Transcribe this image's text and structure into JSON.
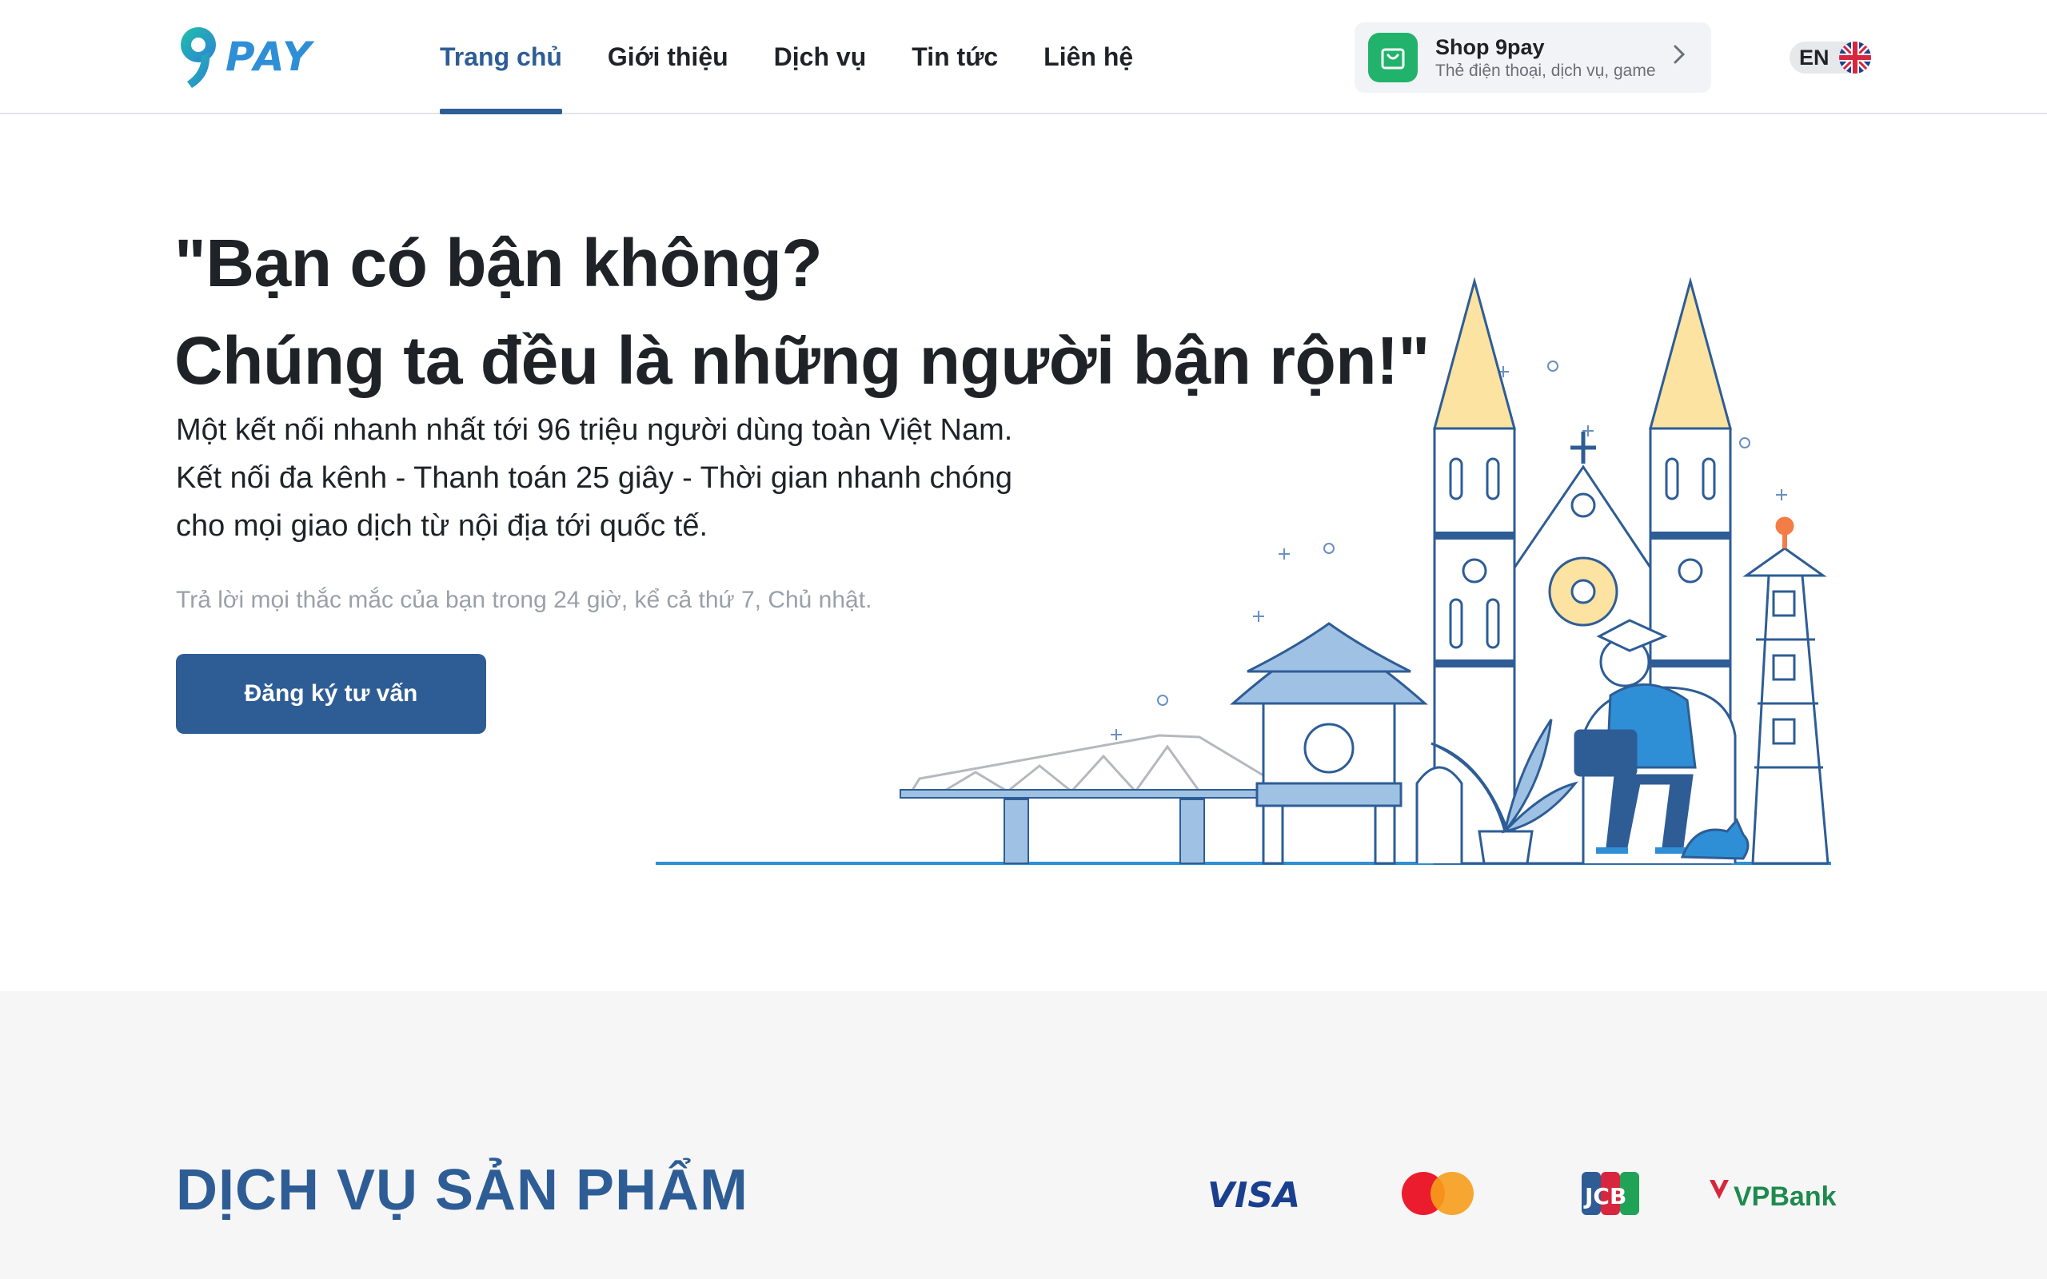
{
  "brand": {
    "logo_text": "PAY",
    "logo_alt": "9pay"
  },
  "nav": {
    "items": [
      {
        "label": "Trang chủ",
        "active": true
      },
      {
        "label": "Giới thiệu",
        "active": false
      },
      {
        "label": "Dịch vụ",
        "active": false
      },
      {
        "label": "Tin tức",
        "active": false
      },
      {
        "label": "Liên hệ",
        "active": false
      }
    ]
  },
  "shop": {
    "title": "Shop 9pay",
    "subtitle": "Thẻ điện thoại, dịch vụ, game",
    "icon": "shopping-bag-icon"
  },
  "language": {
    "label": "EN",
    "flag": "uk-flag-icon"
  },
  "hero": {
    "title_line1": "\"Bạn có bận không?",
    "title_line2": "Chúng ta đều là những người bận rộn!\"",
    "desc_line1": "Một kết nối nhanh nhất tới 96 triệu người dùng toàn Việt Nam.",
    "desc_line2": "Kết nối đa kênh - Thanh toán 25 giây - Thời gian nhanh chóng",
    "desc_line3": "cho mọi giao dịch từ nội địa tới quốc tế.",
    "note": "Trả lời mọi thắc mắc của bạn trong 24 giờ, kể cả thứ 7, Chủ nhật.",
    "cta_label": "Đăng ký tư vấn"
  },
  "products": {
    "title": "DỊCH VỤ SẢN PHẨM",
    "partners": [
      {
        "name": "VISA"
      },
      {
        "name": "mastercard"
      },
      {
        "name": "JCB"
      },
      {
        "name": "VPBank"
      }
    ]
  },
  "colors": {
    "primary": "#2e5d96",
    "shop_green": "#21b36b",
    "accent_blue": "#2f8fd6"
  }
}
